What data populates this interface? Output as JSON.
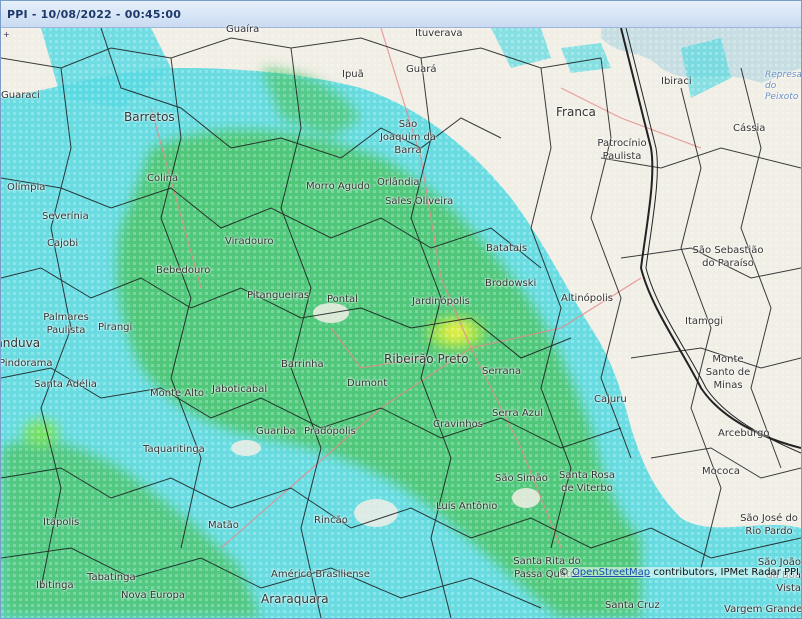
{
  "window": {
    "title": "PPI - 10/08/2022 - 00:45:00"
  },
  "map": {
    "attribution_prefix": "©",
    "attribution_link": "OpenStreetMap",
    "attribution_suffix": "contributors, IPMet Radar PPI",
    "places": [
      {
        "id": "guaira",
        "name": "Guaíra"
      },
      {
        "id": "ituverava",
        "name": "Ituverava"
      },
      {
        "id": "ipua",
        "name": "Ipuã"
      },
      {
        "id": "guara",
        "name": "Guará"
      },
      {
        "id": "ibiraci",
        "name": "Ibiraci"
      },
      {
        "id": "represa",
        "name": "Represa do Peixoto"
      },
      {
        "id": "guaraci",
        "name": "Guaraci"
      },
      {
        "id": "barretos",
        "name": "Barretos"
      },
      {
        "id": "sjbarra",
        "name": "São Joaquim da Barra"
      },
      {
        "id": "franca",
        "name": "Franca"
      },
      {
        "id": "patrocinio",
        "name": "Patrocínio Paulista"
      },
      {
        "id": "cassia",
        "name": "Cássia"
      },
      {
        "id": "olimpia",
        "name": "Olímpia"
      },
      {
        "id": "colina",
        "name": "Colina"
      },
      {
        "id": "morroagudo",
        "name": "Morro Agudo"
      },
      {
        "id": "orlandia",
        "name": "Orlândia"
      },
      {
        "id": "salesoliveira",
        "name": "Sales Oliveira"
      },
      {
        "id": "severinia",
        "name": "Severínia"
      },
      {
        "id": "cajobi",
        "name": "Cajobi"
      },
      {
        "id": "viradouro",
        "name": "Viradouro"
      },
      {
        "id": "batatais",
        "name": "Batatais"
      },
      {
        "id": "ssparaiso",
        "name": "São Sebastião do Paraíso"
      },
      {
        "id": "bebedouro",
        "name": "Bebedouro"
      },
      {
        "id": "brodowski",
        "name": "Brodowski"
      },
      {
        "id": "pitangueiras",
        "name": "Pitangueiras"
      },
      {
        "id": "pontal",
        "name": "Pontal"
      },
      {
        "id": "jardinopolis",
        "name": "Jardinópolis"
      },
      {
        "id": "altinopolis",
        "name": "Altinópolis"
      },
      {
        "id": "palmares",
        "name": "Palmares Paulista"
      },
      {
        "id": "pirangi",
        "name": "Pirangi"
      },
      {
        "id": "itamogi",
        "name": "Itamogi"
      },
      {
        "id": "catanduva",
        "name": "Catanduva"
      },
      {
        "id": "pindorama",
        "name": "Pindorama"
      },
      {
        "id": "barrinha",
        "name": "Barrinha"
      },
      {
        "id": "ribeirao",
        "name": "Ribeirão Preto"
      },
      {
        "id": "montesanto",
        "name": "Monte Santo de Minas"
      },
      {
        "id": "santaadelia",
        "name": "Santa Adélia"
      },
      {
        "id": "serrana",
        "name": "Serrana"
      },
      {
        "id": "dumont",
        "name": "Dumont"
      },
      {
        "id": "jaboticabal",
        "name": "Jaboticabal"
      },
      {
        "id": "montealto",
        "name": "Monte Alto"
      },
      {
        "id": "cajuru",
        "name": "Cajuru"
      },
      {
        "id": "serraazul",
        "name": "Serra Azul"
      },
      {
        "id": "cravinhos",
        "name": "Cravinhos"
      },
      {
        "id": "guariba",
        "name": "Guariba"
      },
      {
        "id": "pradopolis",
        "name": "Pradópolis"
      },
      {
        "id": "arceburgo",
        "name": "Arceburgo"
      },
      {
        "id": "taquaritinga",
        "name": "Taquaritinga"
      },
      {
        "id": "mococa",
        "name": "Mococa"
      },
      {
        "id": "saosimao",
        "name": "São Simão"
      },
      {
        "id": "santarosa",
        "name": "Santa Rosa de Viterbo"
      },
      {
        "id": "itapolis",
        "name": "Itápolis"
      },
      {
        "id": "luisantonio",
        "name": "Luís Antônio"
      },
      {
        "id": "sjriopardo",
        "name": "São José do Rio Pardo"
      },
      {
        "id": "matao",
        "name": "Matão"
      },
      {
        "id": "rincao",
        "name": "Rincão"
      },
      {
        "id": "santaritapq",
        "name": "Santa Rita do Passa Quatro"
      },
      {
        "id": "sjgrama",
        "name": "São João da Boa Vista"
      },
      {
        "id": "ibitinga",
        "name": "Ibitinga"
      },
      {
        "id": "tabatinga",
        "name": "Tabatinga"
      },
      {
        "id": "americob",
        "name": "Américo Brasiliense"
      },
      {
        "id": "novaeuropa",
        "name": "Nova Europa"
      },
      {
        "id": "araraquara",
        "name": "Araraquara"
      },
      {
        "id": "santacruz",
        "name": "Santa Cruz"
      },
      {
        "id": "vargem",
        "name": "Vargem Grande"
      }
    ]
  }
}
